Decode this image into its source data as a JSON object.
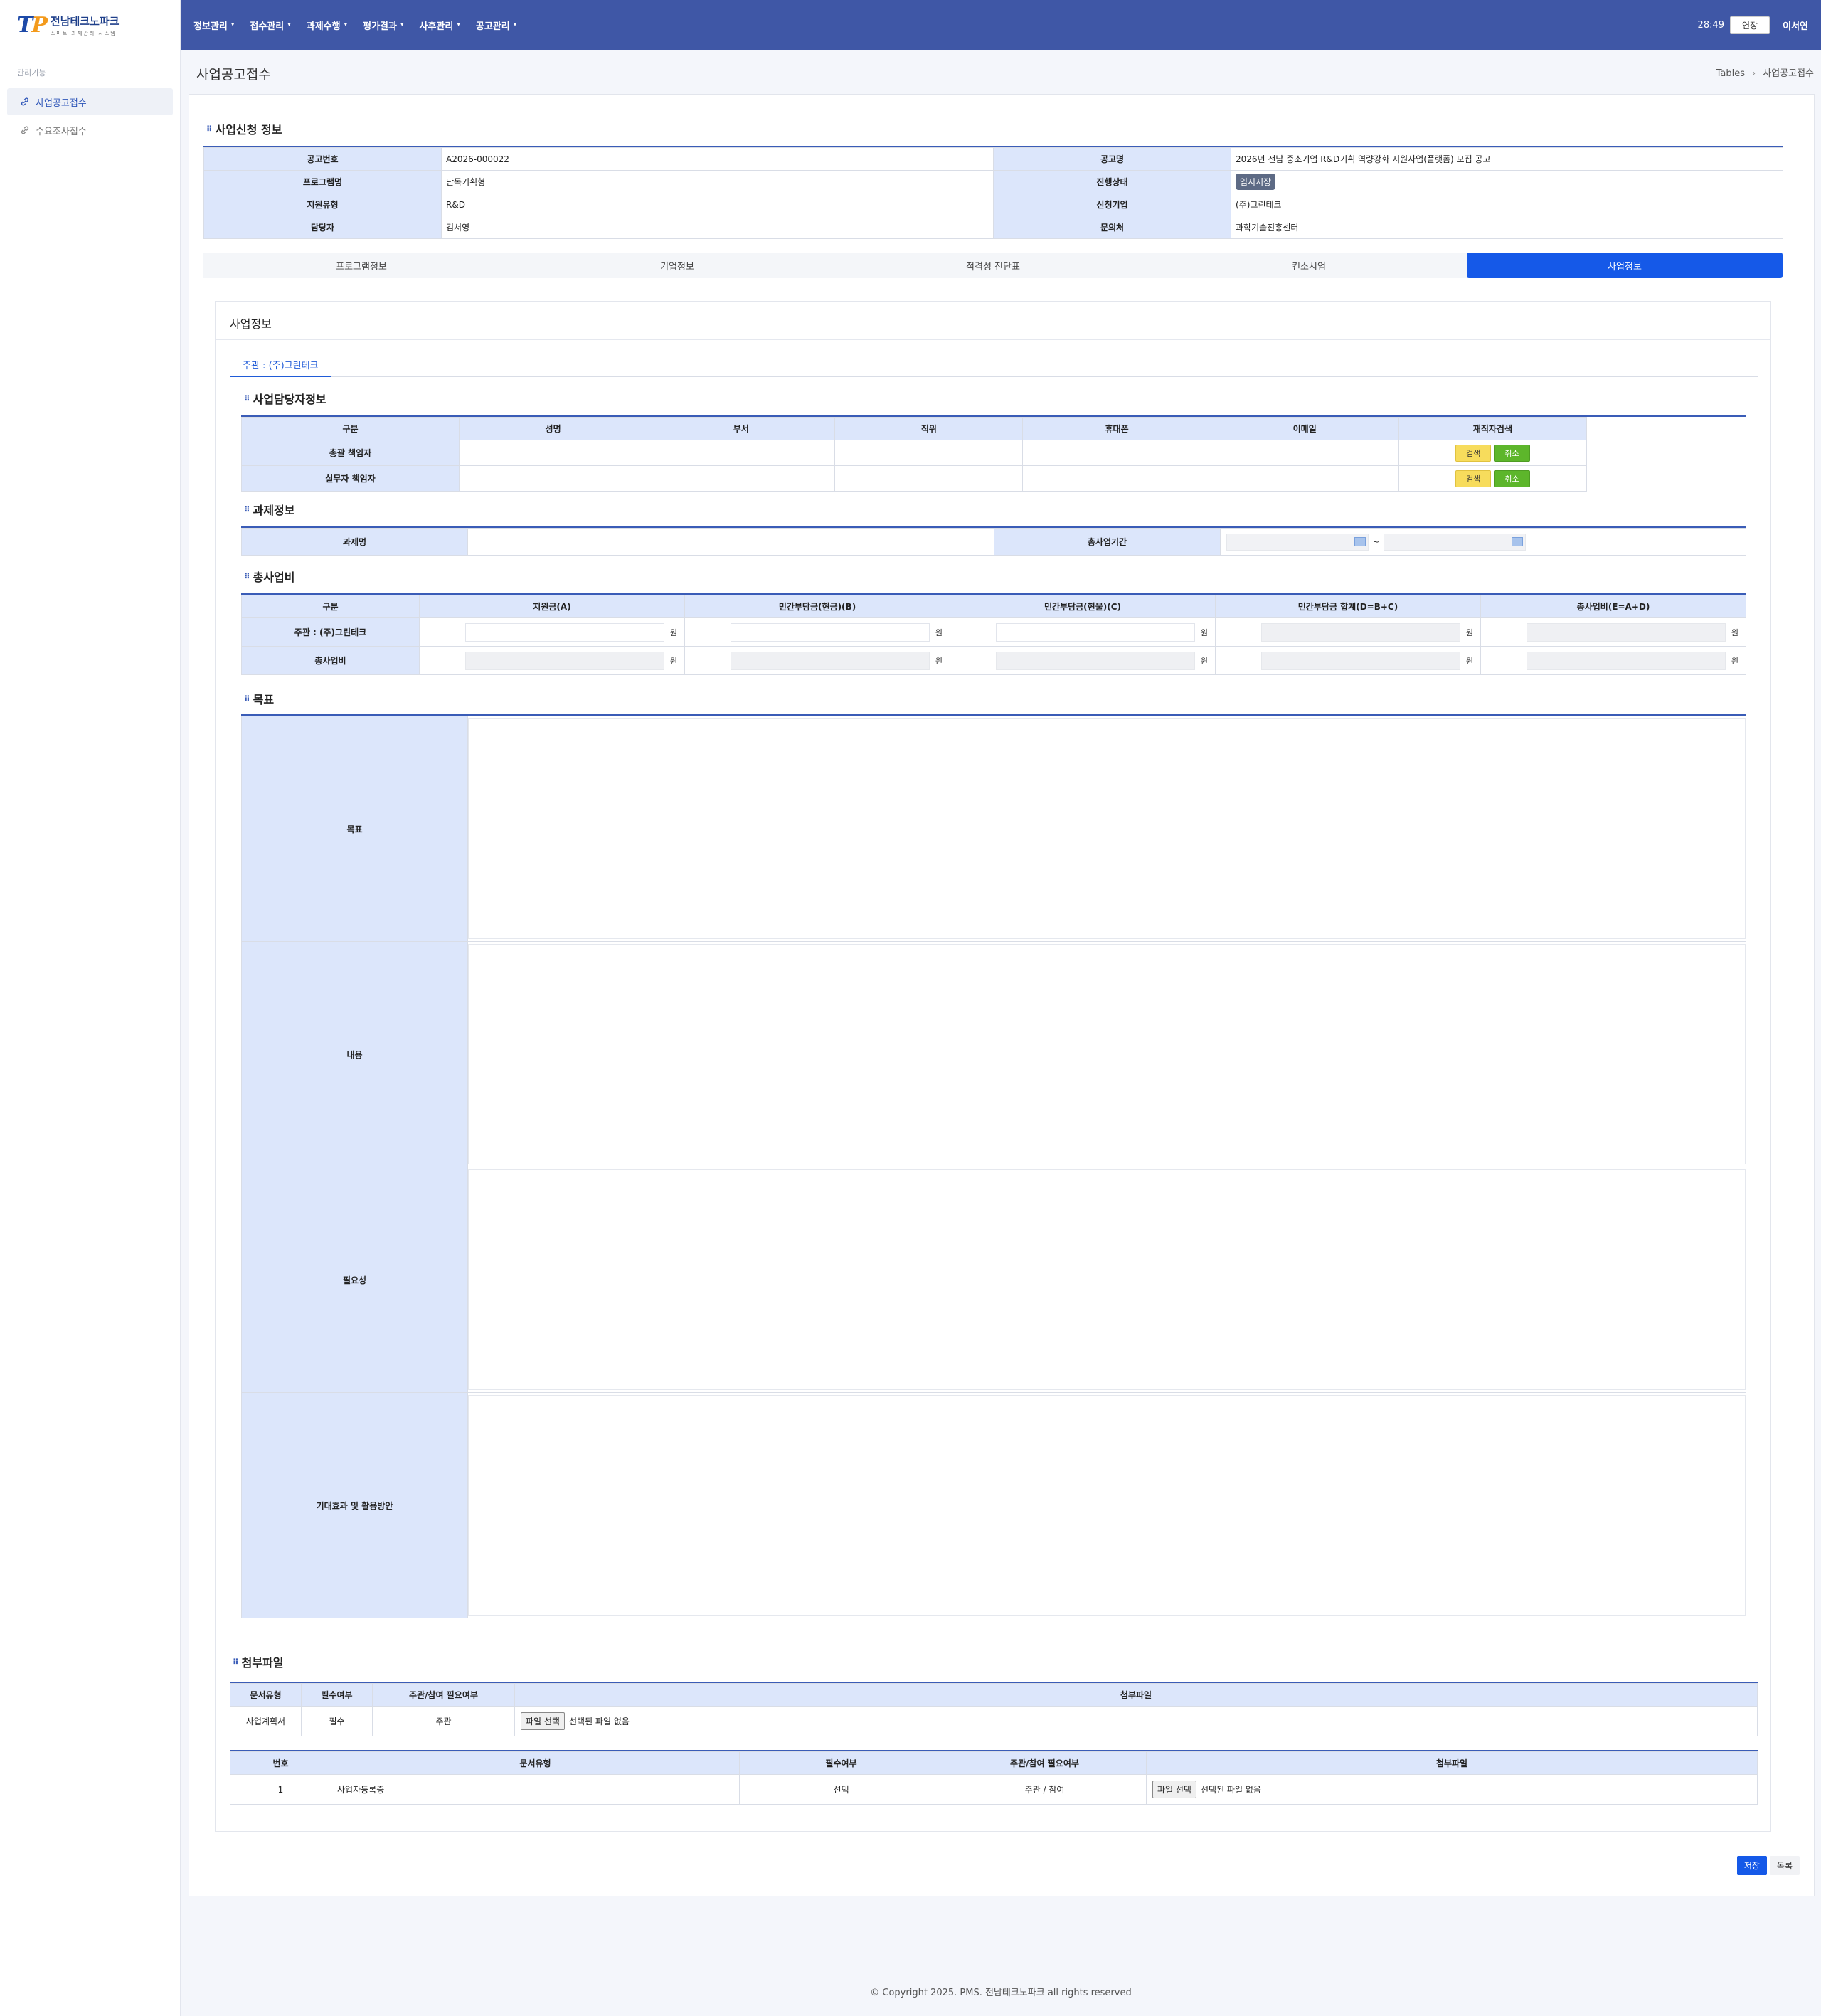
{
  "app": {
    "logo_mark": "TP",
    "logo_name": "전남테크노파크",
    "logo_sub": "스마트 과제관리 시스템"
  },
  "sidebar": {
    "section": "관리기능",
    "items": [
      {
        "label": "사업공고접수",
        "active": true
      },
      {
        "label": "수요조사접수",
        "active": false
      }
    ]
  },
  "topnav": {
    "items": [
      "정보관리",
      "접수관리",
      "과제수행",
      "평가결과",
      "사후관리",
      "공고관리"
    ],
    "timer": "28:49",
    "extend_label": "연장",
    "user": "이서연"
  },
  "page": {
    "title": "사업공고접수",
    "breadcrumb": [
      "Tables",
      "사업공고접수"
    ]
  },
  "app_info": {
    "title": "사업신청 정보",
    "rows": [
      {
        "l1": "공고번호",
        "v1": "A2026-000022",
        "l2": "공고명",
        "v2": "2026년 전남 중소기업 R&D기획 역량강화 지원사업(플랫폼) 모집 공고"
      },
      {
        "l1": "프로그램명",
        "v1": "단독기획형",
        "l2": "진행상태",
        "v2": "임시저장"
      },
      {
        "l1": "지원유형",
        "v1": "R&D",
        "l2": "신청기업",
        "v2": "(주)그린테크"
      },
      {
        "l1": "담당자",
        "v1": "김서영",
        "l2": "문의처",
        "v2": "과학기술진흥센터"
      }
    ]
  },
  "tabs": [
    "프로그램정보",
    "기업정보",
    "적격성 진단표",
    "컨소시엄",
    "사업정보"
  ],
  "business": {
    "heading": "사업정보",
    "subtab": "주관 : (주)그린테크",
    "manager": {
      "title": "사업담당자정보",
      "headers": [
        "구분",
        "성명",
        "부서",
        "직위",
        "휴대폰",
        "이메일",
        "재직자검색"
      ],
      "rows": [
        "총괄 책임자",
        "실무자 책임자"
      ],
      "search_label": "검색",
      "cancel_label": "취소"
    },
    "task": {
      "title": "과제정보",
      "name_label": "과제명",
      "period_label": "총사업기간",
      "separator": "~"
    },
    "cost": {
      "title": "총사업비",
      "headers": [
        "구분",
        "지원금(A)",
        "민간부담금(현금)(B)",
        "민간부담금(현물)(C)",
        "민간부담금 합계(D=B+C)",
        "총사업비(E=A+D)"
      ],
      "rows": [
        "주관 : (주)그린테크",
        "총사업비"
      ],
      "unit": "원"
    },
    "goal": {
      "title": "목표",
      "rows": [
        "목표",
        "내용",
        "필요성",
        "기대효과 및 활용방안"
      ]
    },
    "attach": {
      "title": "첨부파일",
      "headers1": [
        "문서유형",
        "필수여부",
        "주관/참여 필요여부",
        "첨부파일"
      ],
      "row1": {
        "type": "사업계획서",
        "required": "필수",
        "who": "주관"
      },
      "headers2": [
        "번호",
        "문서유형",
        "필수여부",
        "주관/참여 필요여부",
        "첨부파일"
      ],
      "row2": {
        "no": "1",
        "type": "사업자등록증",
        "required": "선택",
        "who": "주관 / 참여"
      },
      "file_btn": "파일 선택",
      "no_file": "선택된 파일 없음"
    }
  },
  "actions": {
    "save": "저장",
    "list": "목록"
  },
  "footer": "© Copyright 2025. PMS. 전남테크노파크 all rights reserved",
  "colors": {
    "topbar": "#3f57a6",
    "accent": "#1559e8",
    "th_bg": "#dce6fb",
    "search": "#f7dc5c",
    "cancel": "#5db62b"
  }
}
